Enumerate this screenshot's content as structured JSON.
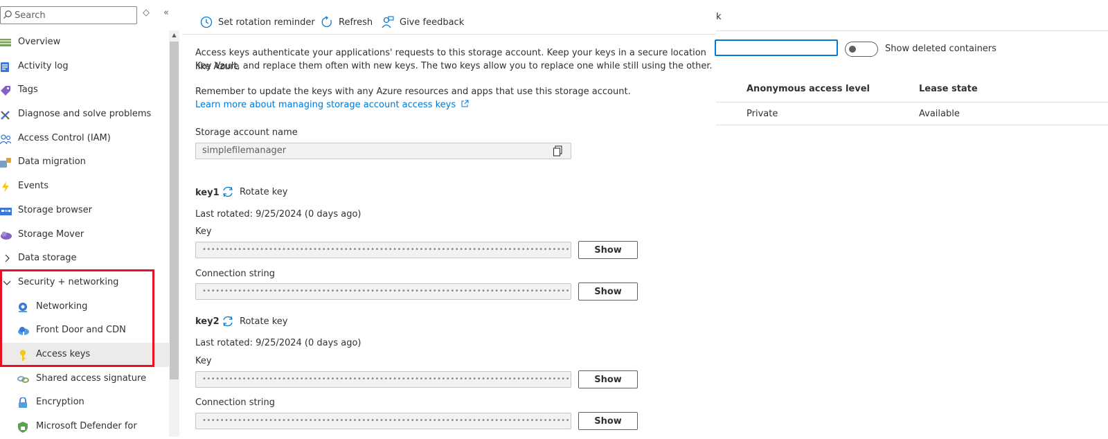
{
  "sidebar": {
    "search_placeholder": "Search",
    "collapse_glyph": "«",
    "sort_glyph": "◇",
    "items": [
      {
        "label": "Overview",
        "icon": "overview-icon"
      },
      {
        "label": "Activity log",
        "icon": "activity-log-icon"
      },
      {
        "label": "Tags",
        "icon": "tag-icon"
      },
      {
        "label": "Diagnose and solve problems",
        "icon": "wrench-icon"
      },
      {
        "label": "Access Control (IAM)",
        "icon": "people-icon"
      },
      {
        "label": "Data migration",
        "icon": "migration-icon"
      },
      {
        "label": "Events",
        "icon": "lightning-icon"
      },
      {
        "label": "Storage browser",
        "icon": "storage-browser-icon"
      },
      {
        "label": "Storage Mover",
        "icon": "cloud-mover-icon"
      },
      {
        "label": "Data storage",
        "icon": "chevron-right-icon"
      },
      {
        "label": "Security + networking",
        "icon": "chevron-down-icon"
      },
      {
        "label": "Networking",
        "icon": "networking-icon"
      },
      {
        "label": "Front Door and CDN",
        "icon": "cloud-cdn-icon"
      },
      {
        "label": "Access keys",
        "icon": "key-icon"
      },
      {
        "label": "Shared access signature",
        "icon": "link-icon"
      },
      {
        "label": "Encryption",
        "icon": "lock-icon"
      },
      {
        "label": "Microsoft Defender for",
        "icon": "shield-icon"
      }
    ]
  },
  "toolbar": {
    "rotation_reminder": "Set rotation reminder",
    "refresh": "Refresh",
    "feedback": "Give feedback"
  },
  "main": {
    "intro_line1": "Access keys authenticate your applications' requests to this storage account. Keep your keys in a secure location like Azure",
    "intro_line2": "Key Vault, and replace them often with new keys. The two keys allow you to replace one while still using the other.",
    "reminder": "Remember to update the keys with any Azure resources and apps that use this storage account.",
    "learn_more": "Learn more about managing storage account access keys",
    "account_name_label": "Storage account name",
    "account_name_value": "simplefilemanager",
    "key1": {
      "title": "key1",
      "rotate": "Rotate key",
      "last_rotated": "Last rotated: 9/25/2024 (0 days ago)",
      "key_label": "Key",
      "key_mask": "••••••••••••••••••••••••••••••••••••••••••••••••••••••••••••••••••••••••••••••••••••••••",
      "conn_label": "Connection string",
      "conn_mask": "•••••••••••••••••••••••••••••••••••••••••••••••••••••••••••••••••••••••••••••••••••••••••••••••…",
      "show": "Show",
      "show_conn": "Show"
    },
    "key2": {
      "title": "key2",
      "rotate": "Rotate key",
      "last_rotated": "Last rotated: 9/25/2024 (0 days ago)",
      "key_label": "Key",
      "key_mask": "••••••••••••••••••••••••••••••••••••••••••••••••••••••••••••••••••••••••••••••••••••••••",
      "conn_label": "Connection string",
      "conn_mask": "•••••••••••••••••••••••••••••••••••••••••••••••••••••••••••••••••••••••••••••••••••••••••••••••…",
      "show": "Show",
      "show_conn": "Show"
    }
  },
  "background_panel": {
    "title_fragment": "k",
    "toggle_label": "Show deleted containers",
    "columns": [
      "Anonymous access level",
      "Lease state"
    ],
    "row": [
      "Private",
      "Available"
    ]
  },
  "colors": {
    "accent": "#0078d4",
    "highlight": "#e81123",
    "field_bg": "#f3f2f1"
  }
}
